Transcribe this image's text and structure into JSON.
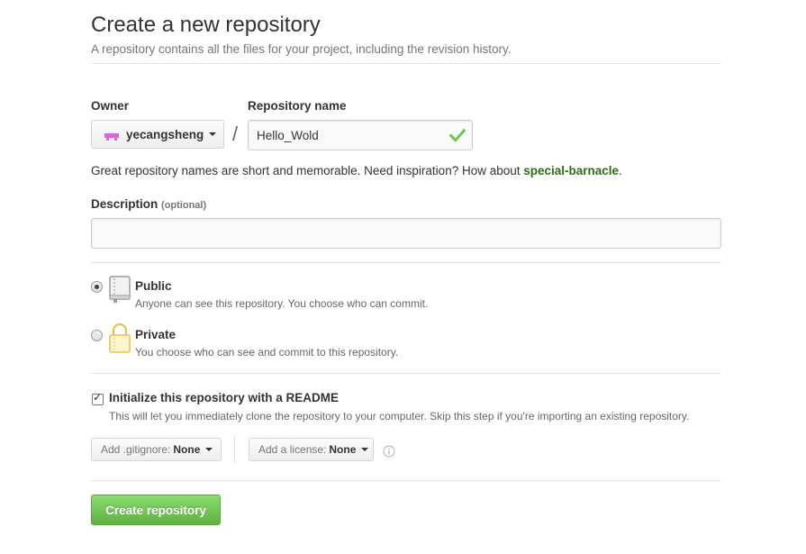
{
  "header": {
    "title": "Create a new repository",
    "subtitle": "A repository contains all the files for your project, including the revision history."
  },
  "owner": {
    "label": "Owner",
    "value": "yecangsheng"
  },
  "repository": {
    "label": "Repository name",
    "value": "Hello_Wold",
    "separator": "/"
  },
  "hint": {
    "text": "Great repository names are short and memorable. Need inspiration? How about ",
    "suggestion": "special-barnacle",
    "end": "."
  },
  "description": {
    "label": "Description",
    "optional": "(optional)",
    "value": ""
  },
  "visibility": {
    "selected": "public",
    "options": [
      {
        "key": "public",
        "title": "Public",
        "desc": "Anyone can see this repository. You choose who can commit.",
        "icon": "repo-book-icon"
      },
      {
        "key": "private",
        "title": "Private",
        "desc": "You choose who can see and commit to this repository.",
        "icon": "lock-icon"
      }
    ]
  },
  "readme": {
    "checked": true,
    "title": "Initialize this repository with a README",
    "desc": "This will let you immediately clone the repository to your computer. Skip this step if you're importing an existing repository."
  },
  "gitignore": {
    "label": "Add .gitignore:",
    "value": "None"
  },
  "license": {
    "label": "Add a license:",
    "value": "None"
  },
  "submit": {
    "label": "Create repository"
  },
  "colors": {
    "accent_green": "#60b044",
    "suggestion_green": "#2c6e14",
    "check_green": "#6cc644",
    "avatar_pink": "#d36bd3"
  }
}
